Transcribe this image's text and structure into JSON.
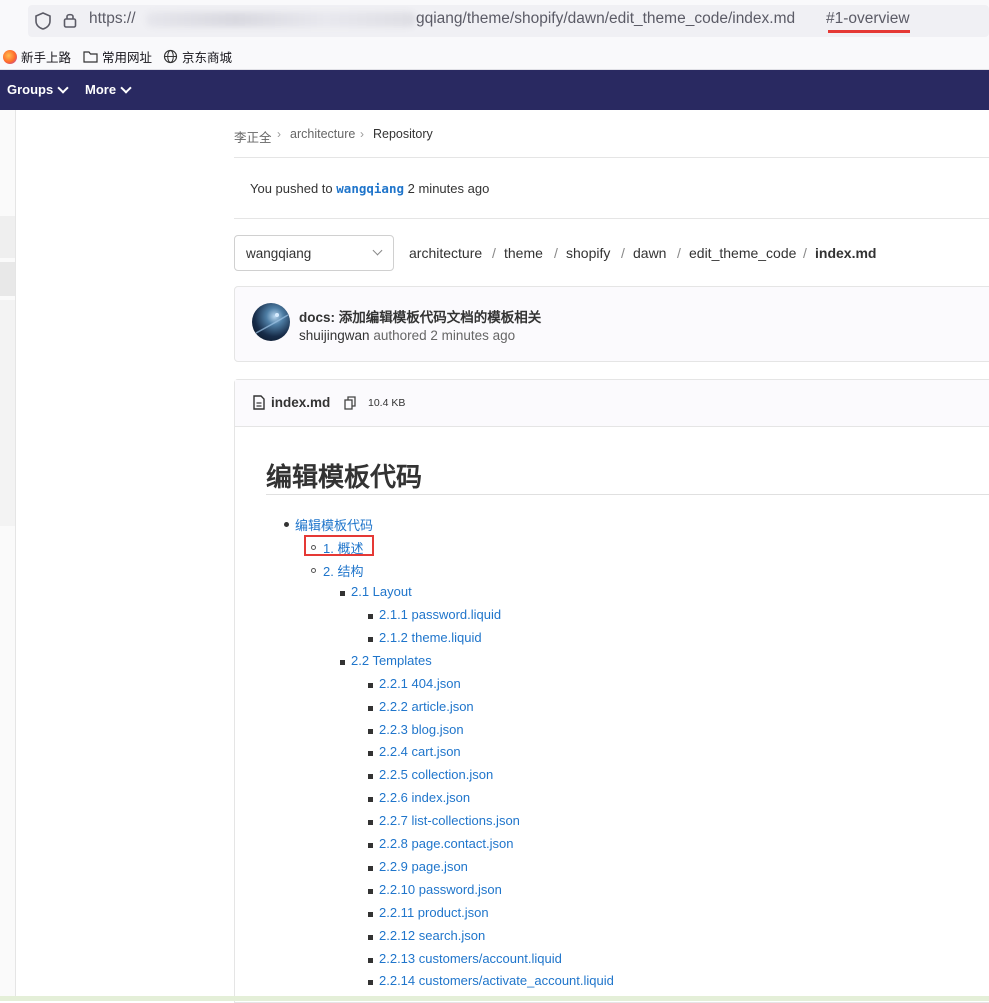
{
  "browser": {
    "url_prefix": "https://",
    "url_suffix": "gqiang/theme/shopify/dawn/edit_theme_code/index.md",
    "url_hash": "#1-overview",
    "bookmarks": [
      "新手上路",
      "常用网址",
      "京东商城"
    ]
  },
  "topnav": {
    "items": [
      "Groups",
      "More"
    ]
  },
  "breadcrumb": {
    "items": [
      "李正全",
      "architecture",
      "Repository"
    ]
  },
  "push_notice": {
    "prefix": "You pushed to",
    "branch": "wangqiang",
    "suffix": "2 minutes ago"
  },
  "ref_selector": {
    "value": "wangqiang"
  },
  "path": {
    "segments": [
      "architecture",
      "theme",
      "shopify",
      "dawn",
      "edit_theme_code"
    ],
    "file": "index.md"
  },
  "commit": {
    "title": "docs: 添加编辑模板代码文档的模板相关",
    "author": "shuijingwan",
    "verb": "authored",
    "time": "2 minutes ago"
  },
  "file": {
    "name": "index.md",
    "size": "10.4 KB"
  },
  "document": {
    "heading": "编辑模板代码",
    "toc": [
      "编辑模板代码",
      "1. 概述",
      "2. 结构",
      "2.1 Layout",
      "2.1.1 password.liquid",
      "2.1.2 theme.liquid",
      "2.2 Templates",
      "2.2.1 404.json",
      "2.2.2 article.json",
      "2.2.3 blog.json",
      "2.2.4 cart.json",
      "2.2.5 collection.json",
      "2.2.6 index.json",
      "2.2.7 list-collections.json",
      "2.2.8 page.contact.json",
      "2.2.9 page.json",
      "2.2.10 password.json",
      "2.2.11 product.json",
      "2.2.12 search.json",
      "2.2.13 customers/account.liquid",
      "2.2.14 customers/activate_account.liquid"
    ]
  },
  "colors": {
    "nav_bg": "#292961",
    "link": "#1f75cb",
    "highlight": "#e53935"
  }
}
